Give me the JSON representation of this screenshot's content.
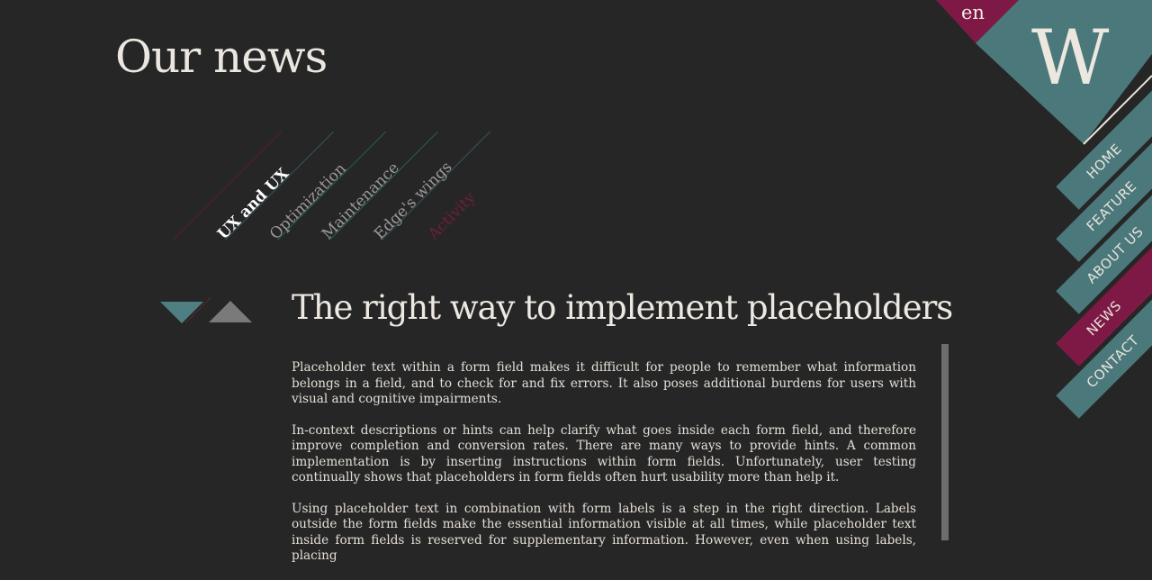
{
  "page": {
    "title": "Our news"
  },
  "categories": [
    {
      "label": "UX and UX",
      "state": "active"
    },
    {
      "label": "Optimization",
      "state": "normal"
    },
    {
      "label": "Maintenance",
      "state": "normal"
    },
    {
      "label": "Edge's wings",
      "state": "normal"
    },
    {
      "label": "Activity",
      "state": "dim"
    }
  ],
  "pager": {
    "prev_icon": "triangle-down-icon",
    "next_icon": "triangle-up-icon"
  },
  "article": {
    "title": "The right way to implement placeholders",
    "paragraphs": [
      "Placeholder text within a form field makes it difficult for people to remember what information belongs in a field, and to check for and fix errors. It also poses additional burdens for users with visual and cognitive impairments.",
      "In-context descriptions or hints can help clarify what goes inside each form field, and therefore improve completion and conversion rates. There are many ways to provide hints. A common implementation is by inserting instructions within form fields. Unfortunately, user testing continually shows that placeholders in form fields often hurt usability more than help it.",
      "Using placeholder text in combination with form labels is a step in the right direction. Labels outside the form fields make the essential information visible at all times, while placeholder text inside form fields is reserved for supplementary information. However, even when using labels, placing"
    ]
  },
  "header": {
    "language": "en",
    "logo": "W"
  },
  "nav": {
    "items": [
      {
        "label": "HOME",
        "active": false
      },
      {
        "label": "FEATURE",
        "active": false
      },
      {
        "label": "ABOUT US",
        "active": false
      },
      {
        "label": "NEWS",
        "active": true
      },
      {
        "label": "CONTACT",
        "active": false
      }
    ]
  },
  "colors": {
    "background": "#262626",
    "teal": "#4b787b",
    "wine": "#7e1945",
    "text": "#e9e4dd"
  }
}
